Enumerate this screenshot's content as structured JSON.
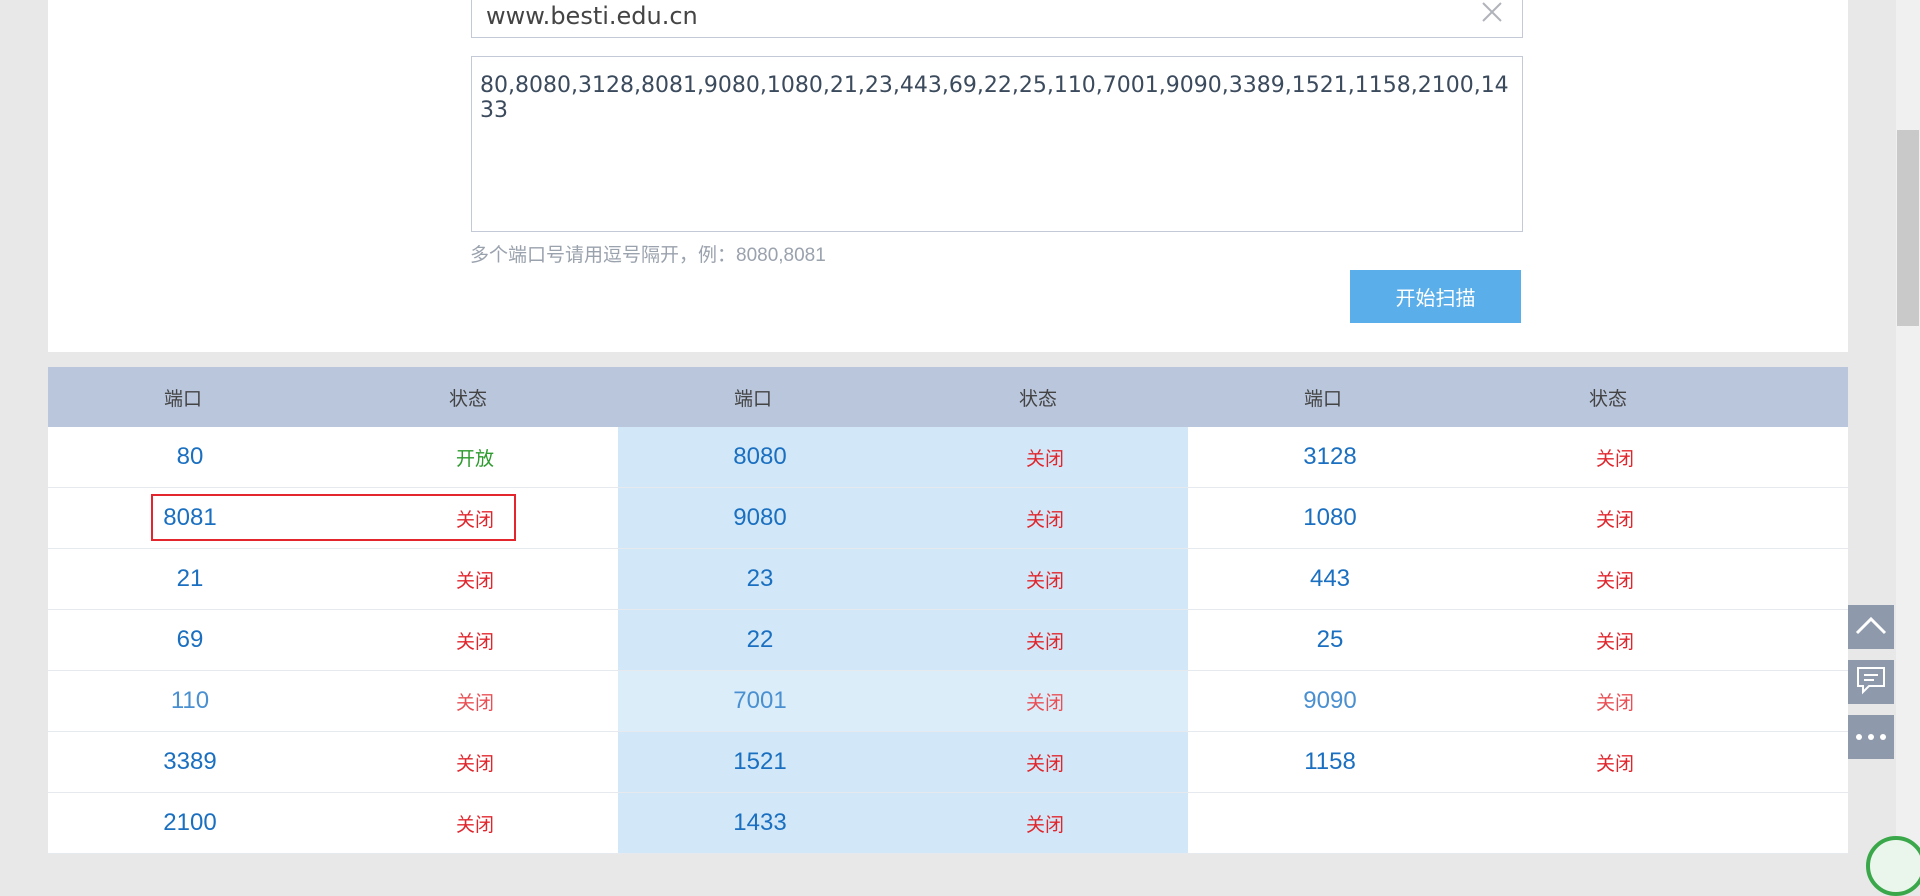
{
  "form": {
    "host_value": "www.besti.edu.cn",
    "ports_value": "80,8080,3128,8081,9080,1080,21,23,443,69,22,25,110,7001,9090,3389,1521,1158,2100,1433",
    "hint": "多个端口号请用逗号隔开，例：8080,8081",
    "scan_label": "开始扫描"
  },
  "results": {
    "headers": [
      "端口",
      "状态",
      "端口",
      "状态",
      "端口",
      "状态"
    ],
    "rows": [
      [
        [
          "80",
          "开放"
        ],
        [
          "8080",
          "关闭"
        ],
        [
          "3128",
          "关闭"
        ]
      ],
      [
        [
          "8081",
          "关闭"
        ],
        [
          "9080",
          "关闭"
        ],
        [
          "1080",
          "关闭"
        ]
      ],
      [
        [
          "21",
          "关闭"
        ],
        [
          "23",
          "关闭"
        ],
        [
          "443",
          "关闭"
        ]
      ],
      [
        [
          "69",
          "关闭"
        ],
        [
          "22",
          "关闭"
        ],
        [
          "25",
          "关闭"
        ]
      ],
      [
        [
          "110",
          "关闭"
        ],
        [
          "7001",
          "关闭"
        ],
        [
          "9090",
          "关闭"
        ]
      ],
      [
        [
          "3389",
          "关闭"
        ],
        [
          "1521",
          "关闭"
        ],
        [
          "1158",
          "关闭"
        ]
      ],
      [
        [
          "2100",
          "关闭"
        ],
        [
          "1433",
          "关闭"
        ],
        [
          "",
          ""
        ]
      ]
    ]
  },
  "icons": {
    "clear": "close-icon",
    "tools": [
      "back-to-top-icon",
      "feedback-icon",
      "more-icon"
    ]
  },
  "colors": {
    "accent": "#5aaeea",
    "open": "#2c9a2c",
    "closed": "#e0262d",
    "port": "#1a6fc0",
    "header_bg": "#b9c6dc"
  }
}
